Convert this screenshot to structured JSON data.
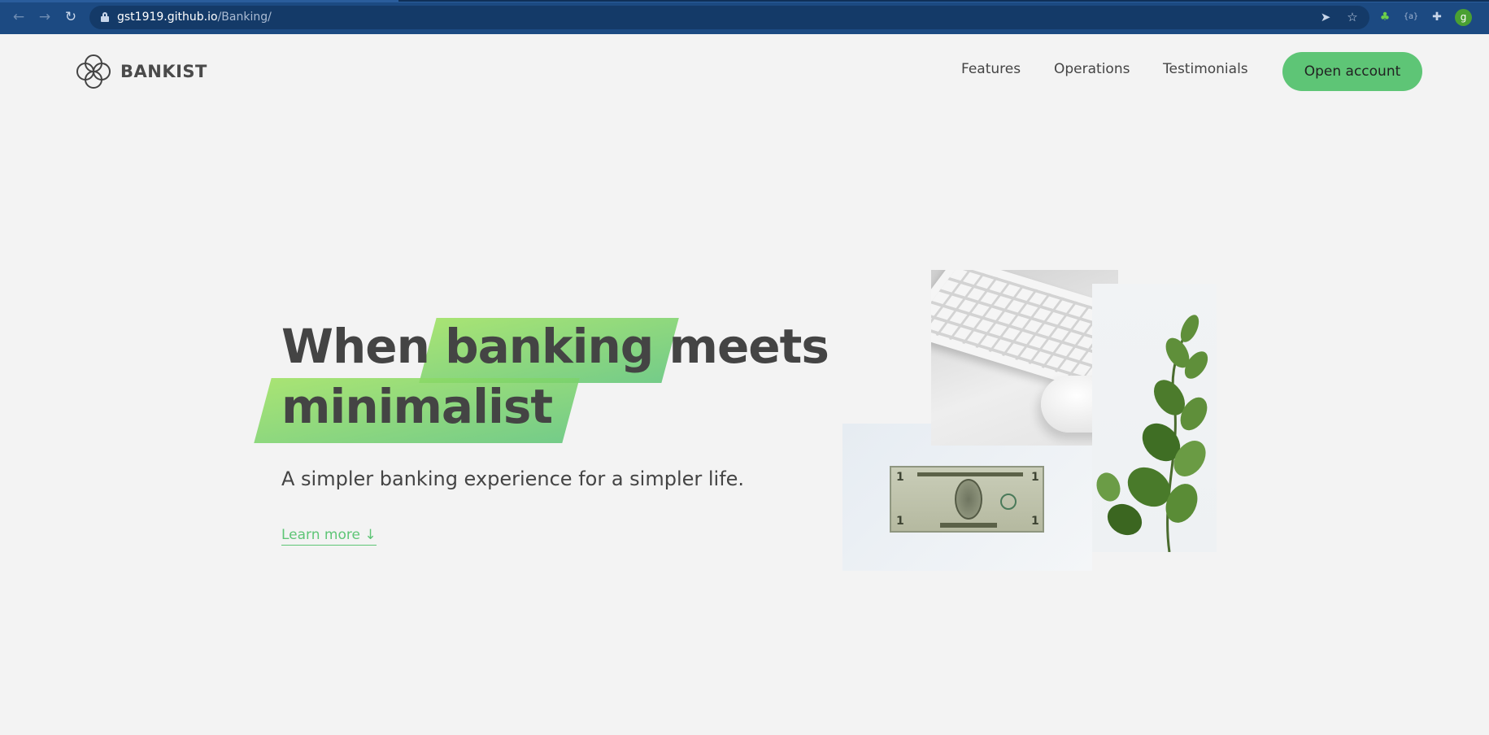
{
  "browser": {
    "url_host": "gst1919.github.io",
    "url_path": "/Banking/",
    "profile_initial": "g",
    "extension_braces": "{a}"
  },
  "brand": {
    "name": "BANKIST"
  },
  "nav": {
    "links": [
      "Features",
      "Operations",
      "Testimonials"
    ],
    "cta": "Open account"
  },
  "hero": {
    "headline_word1": "When",
    "headline_highlight1": "banking",
    "headline_word3": "meets",
    "headline_highlight2": "minimalist",
    "subhead": "A simpler banking experience for a simpler life.",
    "learn_more": "Learn more ↓"
  },
  "colors": {
    "brand_green": "#5ec576",
    "chrome_blue": "#1c4a82",
    "text_dark": "#444444"
  }
}
